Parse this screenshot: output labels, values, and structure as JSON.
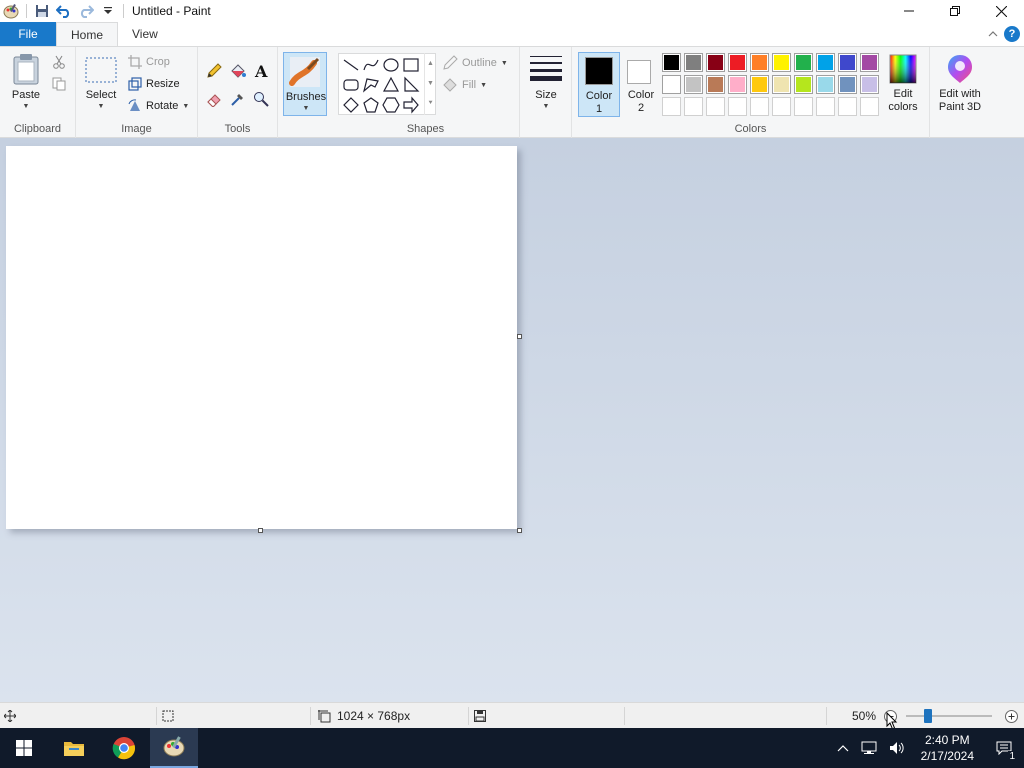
{
  "window": {
    "title": "Untitled - Paint"
  },
  "tabs": {
    "file": "File",
    "home": "Home",
    "view": "View"
  },
  "clipboard": {
    "paste": "Paste",
    "group": "Clipboard"
  },
  "image": {
    "select": "Select",
    "crop": "Crop",
    "resize": "Resize",
    "rotate": "Rotate",
    "group": "Image"
  },
  "tools": {
    "group": "Tools"
  },
  "brushes": {
    "label": "Brushes"
  },
  "shapes": {
    "outline": "Outline",
    "fill": "Fill",
    "group": "Shapes"
  },
  "size": {
    "label": "Size"
  },
  "colors": {
    "color1_line1": "Color",
    "color1_line2": "1",
    "color2_line1": "Color",
    "color2_line2": "2",
    "edit_line1": "Edit",
    "edit_line2": "colors",
    "paint3d_line1": "Edit with",
    "paint3d_line2": "Paint 3D",
    "group": "Colors",
    "color1_value": "#000000",
    "color2_value": "#ffffff",
    "palette_row1": [
      "#000000",
      "#7f7f7f",
      "#880015",
      "#ed1c24",
      "#ff7f27",
      "#fff200",
      "#22b14c",
      "#00a2e8",
      "#3f48cc",
      "#a349a4"
    ],
    "palette_row2": [
      "#ffffff",
      "#c3c3c3",
      "#b97a57",
      "#ffaec9",
      "#ffc90e",
      "#efe4b0",
      "#b5e61d",
      "#99d9ea",
      "#7092be",
      "#c8bfe7"
    ]
  },
  "status": {
    "dimensions": "1024 × 768px",
    "zoom": "50%"
  },
  "taskbar": {
    "time": "2:40 PM",
    "date": "2/17/2024",
    "notifications": "1"
  }
}
